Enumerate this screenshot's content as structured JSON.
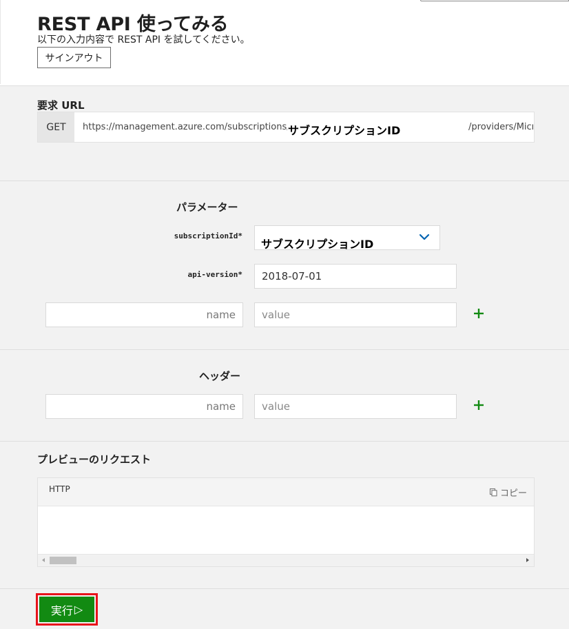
{
  "header": {
    "title": "REST API 使ってみる",
    "subtitle": "以下の入力内容で REST API を試してください。",
    "signout_label": "サインアウト"
  },
  "request_url": {
    "label": "要求 URL",
    "method": "GET",
    "prefix": "https://management.azure.com/subscriptions/{subscriptionId}",
    "subscription_overlay": "サブスクリプションID",
    "suffix": "/providers/Microsoft"
  },
  "parameters": {
    "heading": "パラメーター",
    "subscription_label": "subscriptionId*",
    "subscription_value": "サブスクリプションID",
    "api_version_label": "api-version*",
    "api_version_value": "2018-07-01",
    "name_placeholder": "name",
    "value_placeholder": "value",
    "add_symbol": "+"
  },
  "headers": {
    "heading": "ヘッダー",
    "name_placeholder": "name",
    "value_placeholder": "value",
    "add_symbol": "+"
  },
  "preview": {
    "heading": "プレビューのリクエスト",
    "language": "HTTP",
    "copy_label": "コピー"
  },
  "run": {
    "label": "実行",
    "arrow": "▷"
  },
  "colors": {
    "accent_green": "#128a12",
    "highlight_red": "#e8131b",
    "chevron_blue": "#0063b1"
  },
  "icons": {
    "chevron": "chevron-down-icon",
    "add": "plus-icon",
    "copy": "copy-icon",
    "run": "play-outline-icon"
  }
}
